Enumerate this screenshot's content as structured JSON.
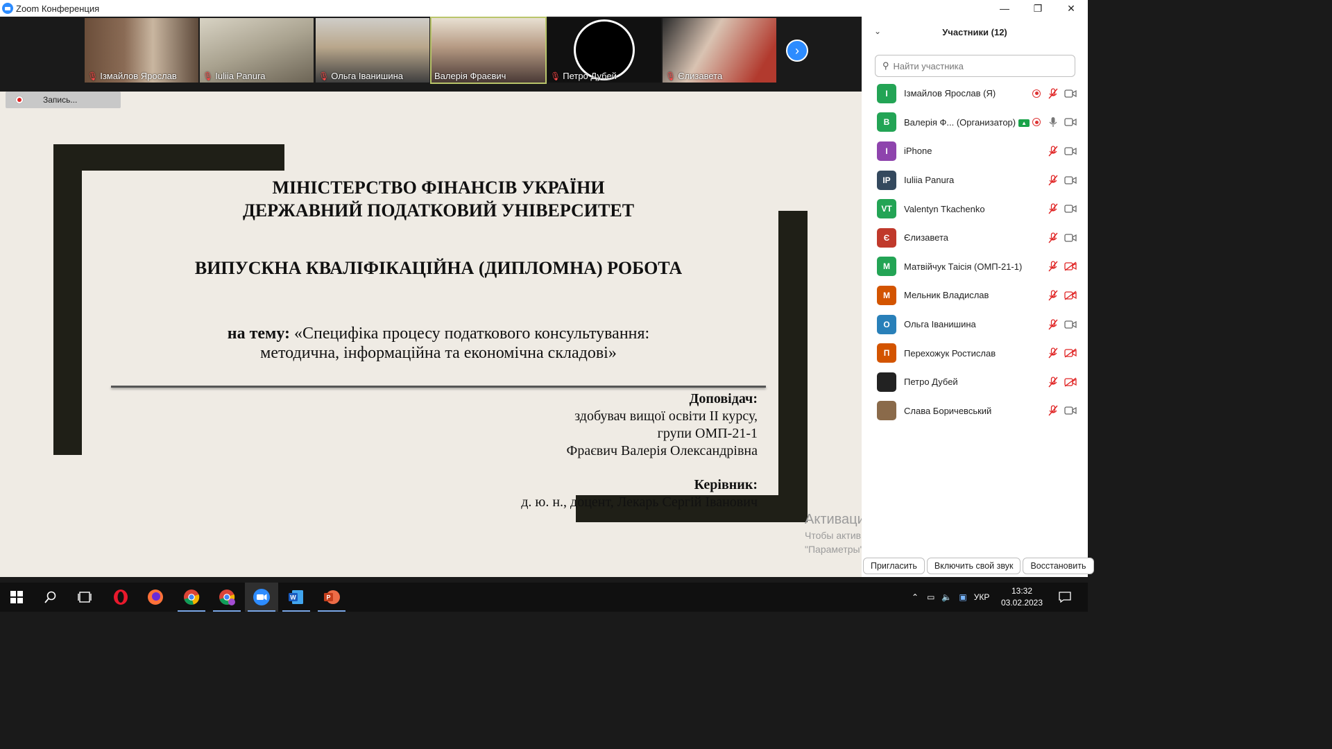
{
  "window": {
    "title": "Zoom Конференция",
    "controls": [
      "—",
      "❐",
      "✕"
    ]
  },
  "video_strip": {
    "participants": [
      {
        "name": "Ізмайлов Ярослав",
        "muted": true
      },
      {
        "name": "Iuliia Panura",
        "muted": true
      },
      {
        "name": "Ольга Іванишина",
        "muted": true
      },
      {
        "name": "Валерія Фраєвич",
        "muted": false,
        "active": true
      },
      {
        "name": "Петро Дубей",
        "muted": true
      },
      {
        "name": "Єлизавета",
        "muted": true
      }
    ]
  },
  "recording": {
    "label": "Запись..."
  },
  "slide": {
    "line1": "МІНІСТЕРСТВО ФІНАНСІВ УКРАЇНИ",
    "line2": "ДЕРЖАВНИЙ ПОДАТКОВИЙ УНІВЕРСИТЕТ",
    "work_title": "ВИПУСКНА КВАЛІФІКАЦІЙНА (ДИПЛОМНА) РОБОТА",
    "topic_label": "на тему:",
    "topic_line1": "«Специфіка процесу податкового консультування:",
    "topic_line2": "методична, інформаційна та економічна складові»",
    "speaker_label": "Доповідач:",
    "speaker_line1": "здобувач вищої освіти ІІ курсу,",
    "speaker_line2": "групи ОМП-21-1",
    "speaker_name": "Фраєвич Валерія Олександрівна",
    "advisor_label": "Керівник:",
    "advisor_name": "д. ю. н., доцент, Лекарь Сергій Іванович"
  },
  "watermark": {
    "title": "Активация Windows",
    "line1": "Чтобы активировать Windows, перейдите в раздел",
    "line2": "\"Параметры\"."
  },
  "participants_panel": {
    "title": "Участники (12)",
    "search_placeholder": "Найти участника",
    "items": [
      {
        "initials": "I",
        "color": "#23a455",
        "name": "Ізмайлов Ярослав (Я)",
        "recording": true,
        "mic": "off",
        "cam": "on"
      },
      {
        "initials": "В",
        "color": "#23a455",
        "name": "Валерія Ф... (Организатор)",
        "host_badge": true,
        "recording": true,
        "mic": "on",
        "cam": "on"
      },
      {
        "initials": "I",
        "color": "#8e44ad",
        "name": "iPhone",
        "mic": "off",
        "cam": "on"
      },
      {
        "initials": "IP",
        "color": "#34495e",
        "name": "Iuliia Panura",
        "mic": "off",
        "cam": "on"
      },
      {
        "initials": "VT",
        "color": "#23a455",
        "name": "Valentyn Tkachenko",
        "mic": "off",
        "cam": "on"
      },
      {
        "initials": "Є",
        "color": "#c0392b",
        "name": "Єлизавета",
        "mic": "off",
        "cam": "on"
      },
      {
        "initials": "М",
        "color": "#23a455",
        "name": "Матвійчук Таісія (ОМП-21-1)",
        "mic": "off",
        "cam": "off"
      },
      {
        "initials": "М",
        "color": "#d35400",
        "name": "Мельник Владислав",
        "mic": "off",
        "cam": "off"
      },
      {
        "initials": "О",
        "color": "#2980b9",
        "name": "Ольга Іванишина",
        "mic": "off",
        "cam": "on"
      },
      {
        "initials": "П",
        "color": "#d35400",
        "name": "Перехожук Ростислав",
        "mic": "off",
        "cam": "off"
      },
      {
        "initials": "",
        "color": "#222222",
        "name": "Петро Дубей",
        "photo": true,
        "mic": "off",
        "cam": "off"
      },
      {
        "initials": "",
        "color": "#8a6a4a",
        "name": "Слава Боричевський",
        "photo": true,
        "mic": "off",
        "cam": "on"
      }
    ],
    "buttons": {
      "invite": "Пригласить",
      "unmute": "Включить свой звук",
      "restore": "Восстановить"
    }
  },
  "taskbar": {
    "language": "УКР",
    "time": "13:32",
    "date": "03.02.2023"
  }
}
